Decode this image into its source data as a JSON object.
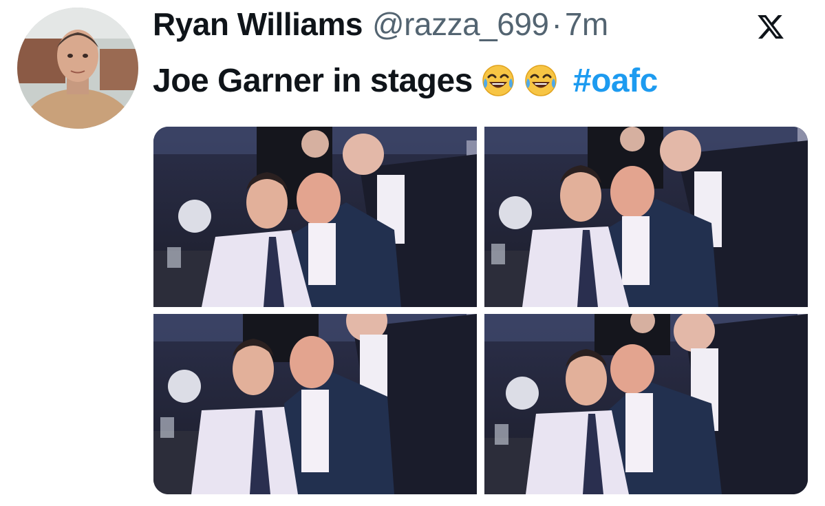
{
  "tweet": {
    "display_name": "Ryan Williams",
    "handle": "@razza_699",
    "separator": "·",
    "time": "7m",
    "text": "Joe Garner in stages",
    "emojis": [
      "face-with-tears-of-joy",
      "face-with-tears-of-joy"
    ],
    "hashtag": "#oafc"
  },
  "icons": {
    "platform_logo": "x-logo"
  },
  "colors": {
    "text_primary": "#0f1419",
    "text_secondary": "#536471",
    "hashtag": "#1d9bf0"
  },
  "media": {
    "photos": [
      {
        "name": "photo-1",
        "scene": "three men at a gala dinner table"
      },
      {
        "name": "photo-2",
        "scene": "three men at a gala dinner table"
      },
      {
        "name": "photo-3",
        "scene": "three men at a gala dinner table"
      },
      {
        "name": "photo-4",
        "scene": "three men at a gala dinner table"
      }
    ]
  }
}
